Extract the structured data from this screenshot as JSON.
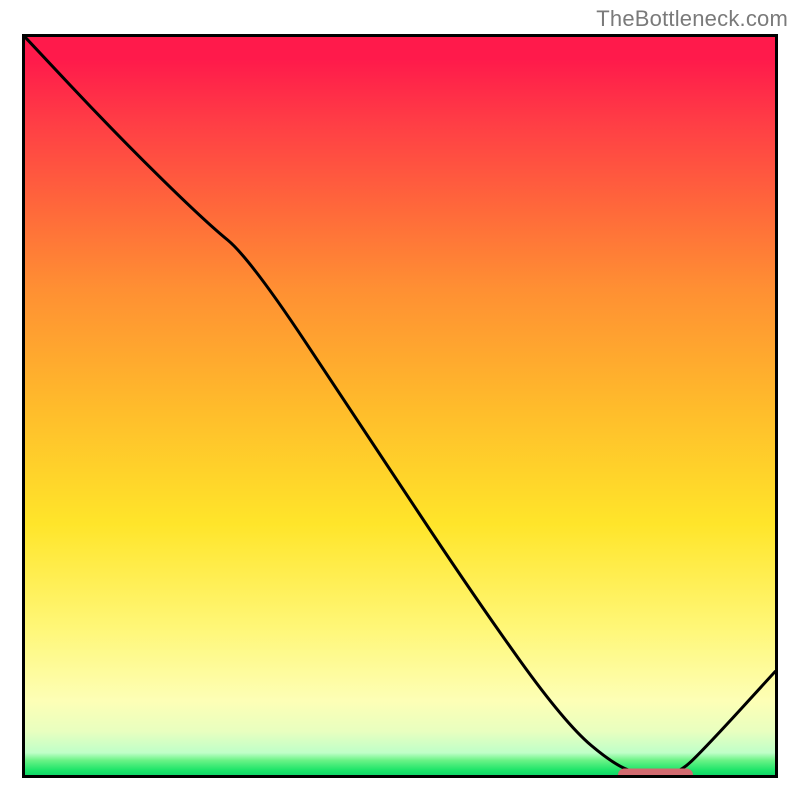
{
  "attribution_label": "TheBottleneck.com",
  "chart_data": {
    "type": "line",
    "title": "",
    "xlabel": "",
    "ylabel": "",
    "xlim": [
      0,
      100
    ],
    "ylim": [
      0,
      100
    ],
    "x": [
      0,
      12,
      24,
      30,
      45,
      60,
      72,
      79,
      83,
      87,
      91,
      100
    ],
    "y": [
      100,
      87,
      75,
      70,
      47,
      24,
      7,
      1,
      0,
      0,
      4,
      14
    ],
    "gradient_stops": [
      {
        "pos": 0,
        "color": "#ff1a4b"
      },
      {
        "pos": 0.5,
        "color": "#ffe52a"
      },
      {
        "pos": 0.97,
        "color": "#bfffc8"
      },
      {
        "pos": 1.0,
        "color": "#0ed767"
      }
    ],
    "marker": {
      "x_start": 79,
      "x_end": 89,
      "y": 0,
      "color": "#d16a6f"
    }
  },
  "plot_geometry": {
    "inner_w": 750,
    "inner_h": 738
  }
}
